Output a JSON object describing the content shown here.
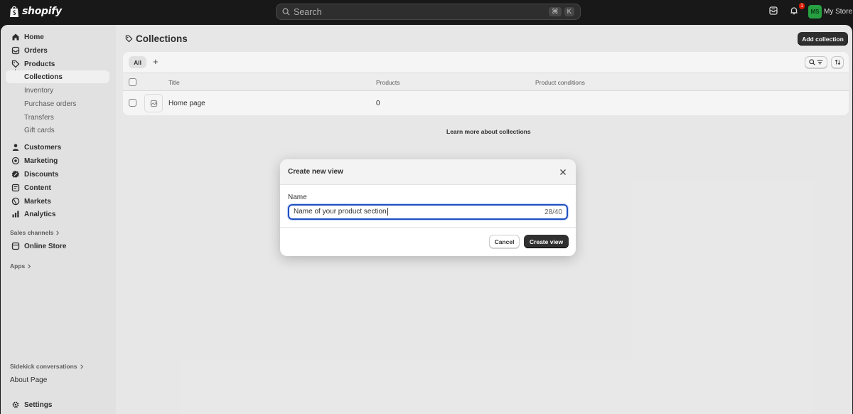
{
  "topbar": {
    "brand": "shopify",
    "search_placeholder": "Search",
    "shortcut_cmd": "⌘",
    "shortcut_key": "K",
    "notification_count": "1",
    "avatar_initials": "MS",
    "store_name": "My Store"
  },
  "sidebar": {
    "items": [
      {
        "label": "Home",
        "icon": "home-icon"
      },
      {
        "label": "Orders",
        "icon": "inbox-icon"
      },
      {
        "label": "Products",
        "icon": "tag-icon"
      },
      {
        "label": "Collections"
      },
      {
        "label": "Inventory"
      },
      {
        "label": "Purchase orders"
      },
      {
        "label": "Transfers"
      },
      {
        "label": "Gift cards"
      },
      {
        "label": "Customers",
        "icon": "person-icon"
      },
      {
        "label": "Marketing",
        "icon": "target-icon"
      },
      {
        "label": "Discounts",
        "icon": "discount-icon"
      },
      {
        "label": "Content",
        "icon": "content-icon"
      },
      {
        "label": "Markets",
        "icon": "globe-icon"
      },
      {
        "label": "Analytics",
        "icon": "chart-icon"
      }
    ],
    "sales_channels_label": "Sales channels",
    "online_store_label": "Online Store",
    "apps_label": "Apps",
    "sidekick_label": "Sidekick conversations",
    "about_page_label": "About Page",
    "settings_label": "Settings"
  },
  "page": {
    "title": "Collections",
    "add_button": "Add collection",
    "tab_all": "All",
    "tab_add": "+",
    "columns": {
      "title": "Title",
      "products": "Products",
      "conditions": "Product conditions"
    },
    "rows": [
      {
        "title": "Home page",
        "products": "0",
        "conditions": ""
      }
    ],
    "learn_more": "Learn more about collections"
  },
  "modal": {
    "title": "Create new view",
    "field_label": "Name",
    "field_value": "Name of your product section",
    "counter": "28/40",
    "cancel": "Cancel",
    "create": "Create view"
  },
  "colors": {
    "topbar_bg": "#1a1a1a",
    "primary_button": "#303030",
    "focus_ring": "#1f4fc2",
    "avatar_bg": "#29a745",
    "badge": "#e51c00"
  }
}
